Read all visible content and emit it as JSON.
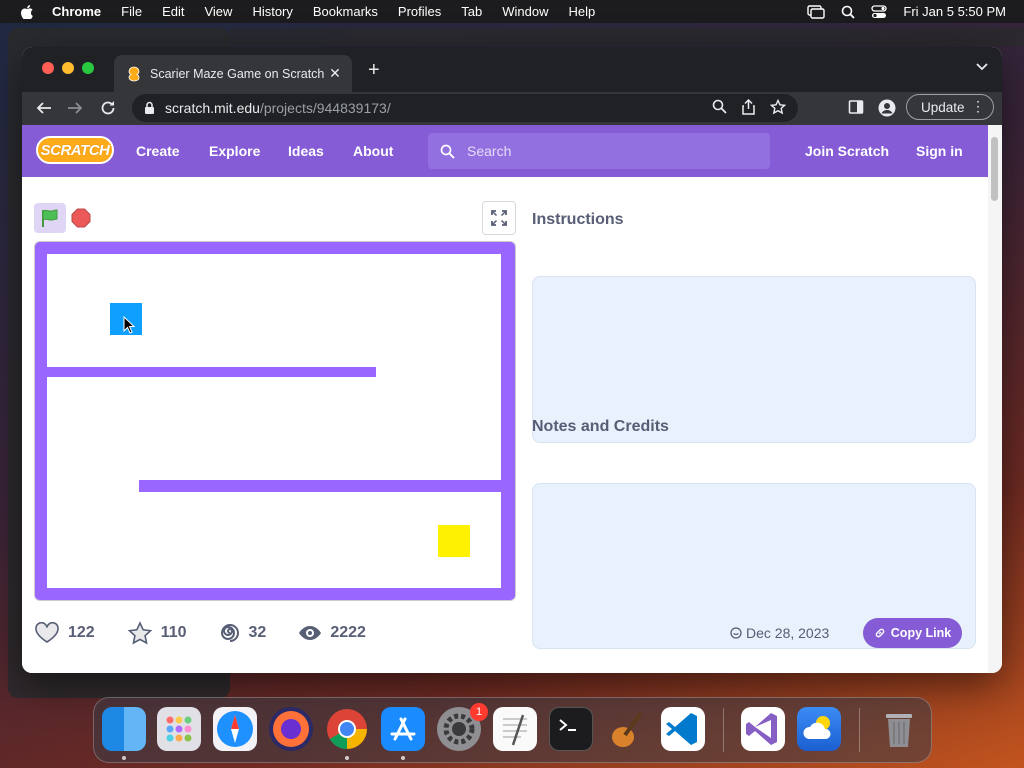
{
  "menubar": {
    "app_name": "Chrome",
    "items": [
      "File",
      "Edit",
      "View",
      "History",
      "Bookmarks",
      "Profiles",
      "Tab",
      "Window",
      "Help"
    ],
    "datetime": "Fri Jan 5  5:50 PM"
  },
  "browser": {
    "tab_title": "Scarier Maze Game on Scratch",
    "url_host": "scratch.mit.edu",
    "url_path": "/projects/944839173/",
    "update_label": "Update"
  },
  "scratch_nav": {
    "logo_text": "SCRATCH",
    "links": [
      "Create",
      "Explore",
      "Ideas",
      "About"
    ],
    "search_placeholder": "Search",
    "join_label": "Join Scratch",
    "signin_label": "Sign in"
  },
  "project": {
    "instructions_title": "Instructions",
    "notes_title": "Notes and Credits",
    "stats": {
      "loves": "122",
      "favorites": "110",
      "remixes": "32",
      "views": "2222"
    },
    "date": "Dec 28, 2023",
    "copy_link_label": "Copy Link"
  },
  "colors": {
    "scratch_purple": "#855cd6",
    "maze_wall": "#9966ff",
    "player_sprite": "#0fa0ff",
    "goal_sprite": "#fff200"
  },
  "dock": {
    "apps": [
      "Finder",
      "Launchpad",
      "Safari",
      "Firefox",
      "Chrome",
      "App Store",
      "System Settings",
      "TextEdit",
      "Terminal",
      "GarageBand",
      "Visual Studio Code",
      "Visual Studio",
      "Weather",
      "Trash"
    ],
    "settings_badge": "1"
  }
}
